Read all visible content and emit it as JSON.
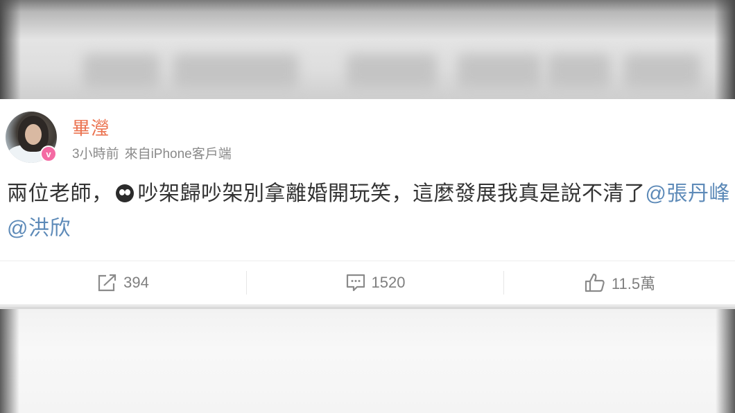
{
  "post": {
    "username": "畢瀅",
    "time": "3小時前",
    "source": "來自iPhone客戶端",
    "text_before_emoji": "兩位老師，",
    "text_after_emoji": "吵架歸吵架別拿離婚開玩笑，這麼發展我真是說不清了",
    "mention_1": "@張丹峰",
    "mention_2": "@洪欣",
    "badge": "v"
  },
  "actions": {
    "repost_count": "394",
    "comment_count": "1520",
    "like_count": "11.5萬"
  },
  "colors": {
    "username": "#eb7350",
    "mention": "#5d8ab8",
    "badge": "#f46aa3",
    "text": "#333333",
    "muted": "#8a8a8a"
  }
}
